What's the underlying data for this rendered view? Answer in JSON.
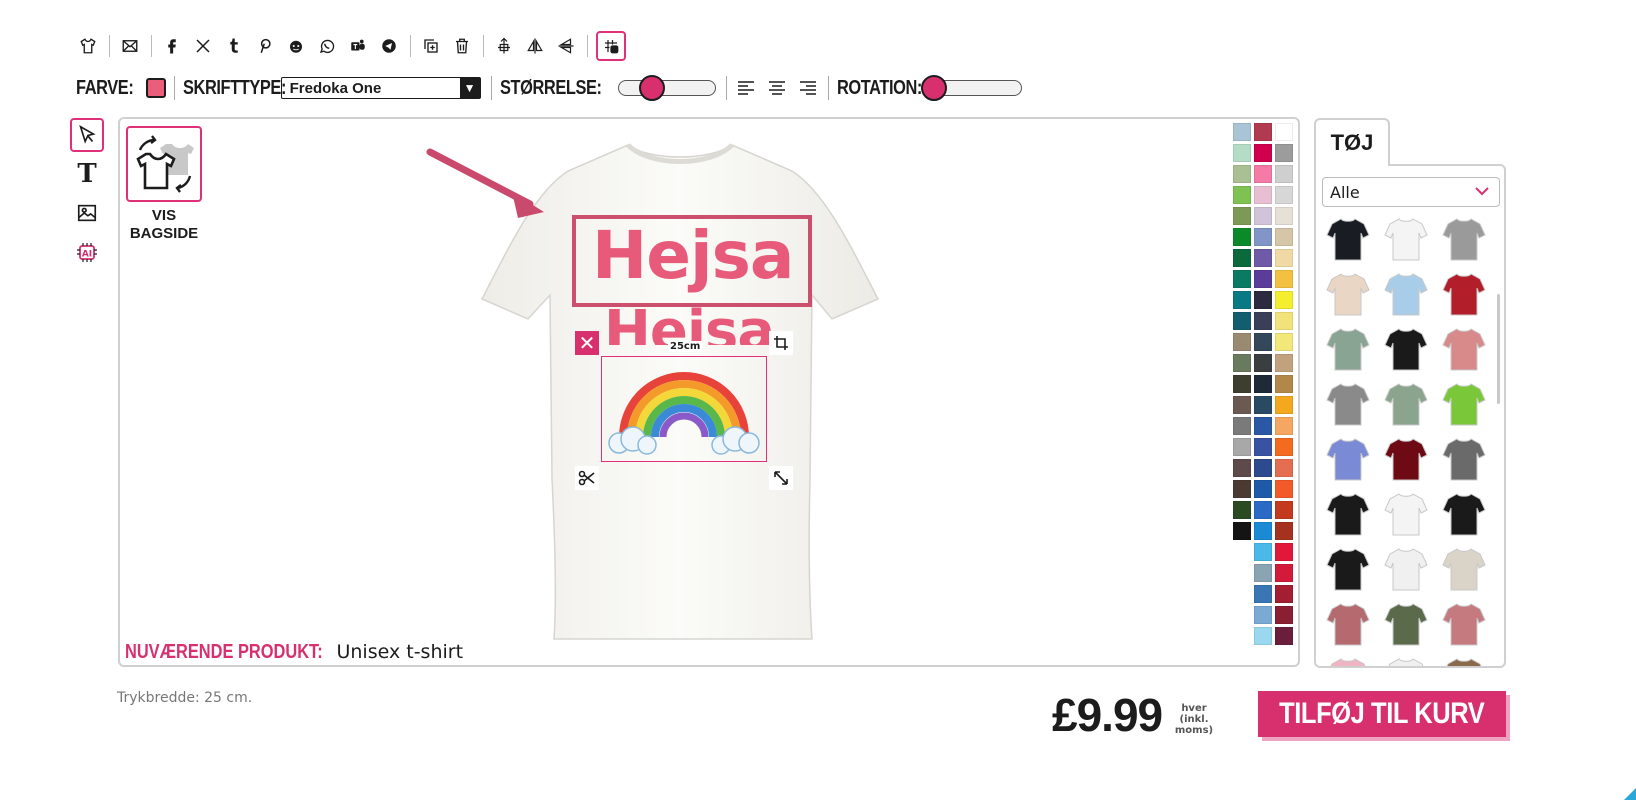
{
  "toolbar": {
    "icons": [
      "tshirt-icon",
      "email-icon",
      "facebook-icon",
      "x-icon",
      "tumblr-icon",
      "pinterest-icon",
      "reddit-icon",
      "whatsapp-icon",
      "teams-icon",
      "telegram-icon",
      "duplicate-icon",
      "delete-icon",
      "center-vertical-icon",
      "flip-horizontal-icon",
      "flip-vertical-icon",
      "grid-toggle-icon"
    ]
  },
  "text_options": {
    "color_label": "FARVE:",
    "color_value": "#ea5e7a",
    "font_label": "SKRIFTTYPE:",
    "font_value": "Fredoka One",
    "size_label": "STØRRELSE:",
    "size_level": 0.35,
    "rotation_label": "ROTATION:",
    "rotation_level": 0.0
  },
  "left_tools": [
    "pointer-icon",
    "text-tool-icon",
    "image-tool-icon",
    "ai-tool-icon"
  ],
  "canvas": {
    "backside_label": "VIS BAGSIDE",
    "text_layers": [
      "Hejsa",
      "Hejsa"
    ],
    "image_width_label": "25cm",
    "current_product_label": "NUVÆRENDE PRODUKT:",
    "current_product_value": "Unisex t-shirt"
  },
  "garment_colors": [
    "#a9c4d4",
    "#b13a50",
    "#ffffff",
    "#b4dcc6",
    "#d0004f",
    "#9c9c9c",
    "#aac094",
    "#f57aa6",
    "#cfcfcf",
    "#7ec252",
    "#e8bfd2",
    "#d7d7d7",
    "#7c9a55",
    "#d2c4d8",
    "#e7e0d6",
    "#0c8a2a",
    "#8196c6",
    "#d6c6a8",
    "#0b6a3c",
    "#6e5aa6",
    "#f0d9a4",
    "#0a7a62",
    "#5a3c9a",
    "#f4c042",
    "#0a7a82",
    "#2c2a3e",
    "#f4ee2e",
    "#135e6e",
    "#3a3e58",
    "#f2e27a",
    "#9a8a72",
    "#34485c",
    "#f2e87a",
    "#6a7a5e",
    "#3a3e3e",
    "#c2a27e",
    "#3e3e30",
    "#1e2a38",
    "#b2884a",
    "#6a5a52",
    "#2a4a64",
    "#f4a81e",
    "#7a7a7a",
    "#2a58a4",
    "#f4a662",
    "#a8a8a8",
    "#3a52a2",
    "#f46a1e",
    "#5e4a4a",
    "#2e4a8e",
    "#e46e52",
    "#4a3a32",
    "#1e5aa8",
    "#f25a2a",
    "#2a4a22",
    "#2a6ac4",
    "#c43a1e",
    "#141414",
    "#1a8ad4",
    "#a4321e",
    "",
    "#4ab8e8",
    "#e2183a",
    "",
    "#8aa4b4",
    "#d41a3a",
    "",
    "#3a76b4",
    "#a41e32",
    "",
    "#7aaad4",
    "#8a1e32",
    "",
    "#9ad8f0",
    "#6a1e3a"
  ],
  "products_panel": {
    "tab_label": "TØJ",
    "filter_value": "Alle",
    "items": [
      {
        "name": "black-tshirt",
        "color": "#1a1c24"
      },
      {
        "name": "raglan-tshirt",
        "color": "#f4f4f4"
      },
      {
        "name": "grey-hoodie",
        "color": "#9a9a9a"
      },
      {
        "name": "sand-tshirt",
        "color": "#ead6c4"
      },
      {
        "name": "tie-dye-tshirt",
        "color": "#a8cde8"
      },
      {
        "name": "varsity-jacket",
        "color": "#b21e2a"
      },
      {
        "name": "sage-longsleeve",
        "color": "#8aa494"
      },
      {
        "name": "orange-hoodie",
        "color": "#1a1a1a"
      },
      {
        "name": "pink-tank",
        "color": "#d88a8a"
      },
      {
        "name": "grey-crop-tshirt",
        "color": "#8a8a8a"
      },
      {
        "name": "ombre-hoodie",
        "color": "#8aa48e"
      },
      {
        "name": "green-polo",
        "color": "#7ac83a"
      },
      {
        "name": "blue-tshirt",
        "color": "#7a8ad4"
      },
      {
        "name": "burgundy-longsleeve",
        "color": "#6e0a14"
      },
      {
        "name": "charcoal-tshirt",
        "color": "#6a6a6a"
      },
      {
        "name": "black-oversized-tee",
        "color": "#1a1a1a"
      },
      {
        "name": "white-tshirt",
        "color": "#f4f4f4"
      },
      {
        "name": "black-tank",
        "color": "#1a1a1a"
      },
      {
        "name": "black-fitted-tee",
        "color": "#1a1a1a"
      },
      {
        "name": "white-tank",
        "color": "#f0f0f0"
      },
      {
        "name": "beige-cardigan",
        "color": "#dad4c8"
      },
      {
        "name": "rose-longsleeve",
        "color": "#b46a6e"
      },
      {
        "name": "olive-crop-top",
        "color": "#5a6a4a"
      },
      {
        "name": "rose-tank",
        "color": "#c47a7e"
      },
      {
        "name": "pink-sweater",
        "color": "#f0b4c4"
      },
      {
        "name": "white-sweater",
        "color": "#f0f0f0"
      },
      {
        "name": "brown-tshirt",
        "color": "#8a6a4a"
      }
    ]
  },
  "footer": {
    "print_width": "Trykbredde: 25 cm.",
    "price": "£9.99",
    "vat_note": "hver (inkl. moms)",
    "add_to_cart": "TILFØJ TIL KURV"
  },
  "colors": {
    "accent": "#d8306f",
    "text_pink": "#e85a79"
  }
}
